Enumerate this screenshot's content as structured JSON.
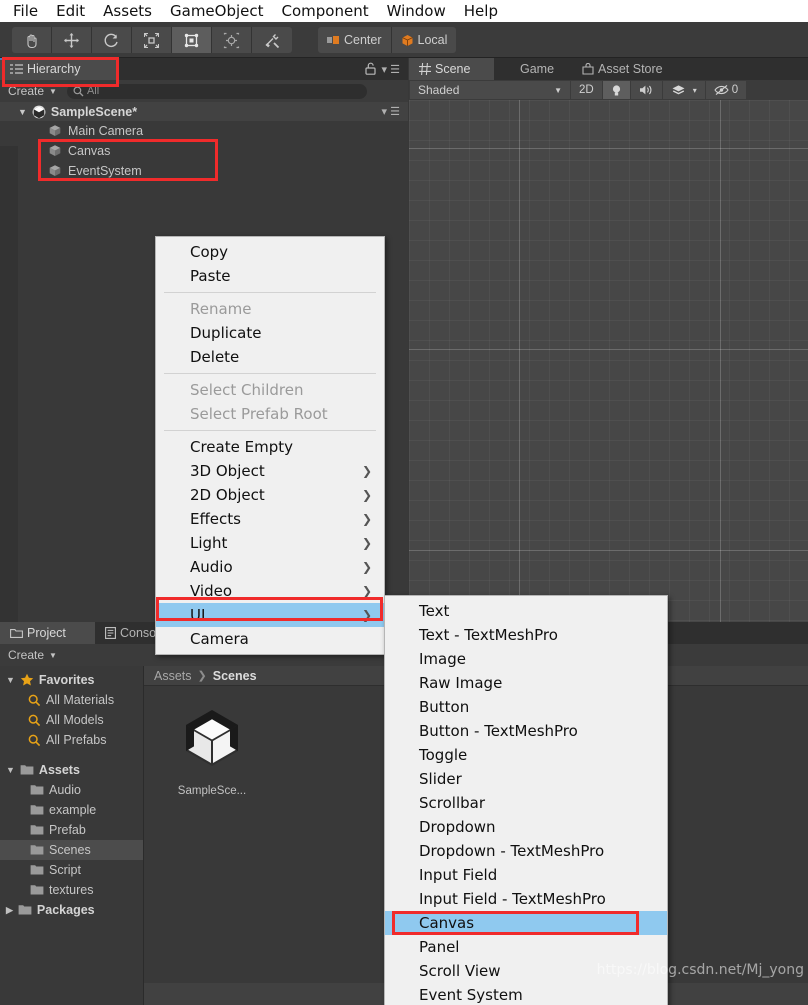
{
  "menubar": {
    "items": [
      "File",
      "Edit",
      "Assets",
      "GameObject",
      "Component",
      "Window",
      "Help"
    ]
  },
  "toolbar": {
    "tools": [
      {
        "name": "hand-tool",
        "icon": "hand-icon",
        "active": false
      },
      {
        "name": "move-tool",
        "icon": "move-icon",
        "active": false
      },
      {
        "name": "rotate-tool",
        "icon": "rotate-icon",
        "active": false
      },
      {
        "name": "scale-tool",
        "icon": "scale-icon",
        "active": false
      },
      {
        "name": "rect-tool",
        "icon": "rect-icon",
        "active": true
      },
      {
        "name": "transform-tool",
        "icon": "transform-icon",
        "active": false
      },
      {
        "name": "custom-tool",
        "icon": "wrench-icon",
        "active": false
      }
    ],
    "pivot_label": "Center",
    "space_label": "Local"
  },
  "hierarchy": {
    "tab_label": "Hierarchy",
    "create_label": "Create",
    "search_value": "All",
    "search_placeholder": "All",
    "scene_name": "SampleScene*",
    "objects": [
      {
        "label": "Main Camera"
      },
      {
        "label": "Canvas"
      },
      {
        "label": "EventSystem"
      }
    ]
  },
  "sceneview": {
    "tabs": [
      {
        "label": "Scene",
        "icon": "grid-icon",
        "active": true
      },
      {
        "label": "Game",
        "icon": "gamepad-icon",
        "active": false
      },
      {
        "label": "Asset Store",
        "icon": "store-icon",
        "active": false
      }
    ],
    "draw_mode": "Shaded",
    "toggle_2d": "2D",
    "lighting_icon": "bulb-icon",
    "audio_icon": "speaker-icon",
    "effects_icon": "fx-icon",
    "visibility_icon": "eye-off-icon",
    "hidden_count": "0"
  },
  "project": {
    "tabs": [
      {
        "label": "Project",
        "icon": "folder-icon",
        "active": true
      },
      {
        "label": "Console",
        "icon": "console-icon",
        "active": false
      }
    ],
    "create_label": "Create",
    "breadcrumb": [
      "Assets",
      "Scenes"
    ],
    "favorites": {
      "label": "Favorites",
      "items": [
        "All Materials",
        "All Models",
        "All Prefabs"
      ]
    },
    "assets": {
      "label": "Assets",
      "items": [
        {
          "label": "Audio",
          "selected": false
        },
        {
          "label": "example",
          "selected": false
        },
        {
          "label": "Prefab",
          "selected": false
        },
        {
          "label": "Scenes",
          "selected": true
        },
        {
          "label": "Script",
          "selected": false
        },
        {
          "label": "textures",
          "selected": false
        }
      ]
    },
    "packages_label": "Packages",
    "asset_items": [
      {
        "label": "SampleSce...",
        "icon": "unity-scene-icon"
      }
    ]
  },
  "context_menu": {
    "items": [
      {
        "label": "Copy",
        "disabled": false,
        "submenu": false,
        "highlighted": false
      },
      {
        "label": "Paste",
        "disabled": false,
        "submenu": false,
        "highlighted": false
      },
      {
        "separator": true
      },
      {
        "label": "Rename",
        "disabled": true,
        "submenu": false,
        "highlighted": false
      },
      {
        "label": "Duplicate",
        "disabled": false,
        "submenu": false,
        "highlighted": false
      },
      {
        "label": "Delete",
        "disabled": false,
        "submenu": false,
        "highlighted": false
      },
      {
        "separator": true
      },
      {
        "label": "Select Children",
        "disabled": true,
        "submenu": false,
        "highlighted": false
      },
      {
        "label": "Select Prefab Root",
        "disabled": true,
        "submenu": false,
        "highlighted": false
      },
      {
        "separator": true
      },
      {
        "label": "Create Empty",
        "disabled": false,
        "submenu": false,
        "highlighted": false
      },
      {
        "label": "3D Object",
        "disabled": false,
        "submenu": true,
        "highlighted": false
      },
      {
        "label": "2D Object",
        "disabled": false,
        "submenu": true,
        "highlighted": false
      },
      {
        "label": "Effects",
        "disabled": false,
        "submenu": true,
        "highlighted": false
      },
      {
        "label": "Light",
        "disabled": false,
        "submenu": true,
        "highlighted": false
      },
      {
        "label": "Audio",
        "disabled": false,
        "submenu": true,
        "highlighted": false
      },
      {
        "label": "Video",
        "disabled": false,
        "submenu": true,
        "highlighted": false
      },
      {
        "label": "UI",
        "disabled": false,
        "submenu": true,
        "highlighted": true
      },
      {
        "label": "Camera",
        "disabled": false,
        "submenu": false,
        "highlighted": false
      }
    ]
  },
  "ui_submenu": {
    "items": [
      {
        "label": "Text",
        "highlighted": false
      },
      {
        "label": "Text - TextMeshPro",
        "highlighted": false
      },
      {
        "label": "Image",
        "highlighted": false
      },
      {
        "label": "Raw Image",
        "highlighted": false
      },
      {
        "label": "Button",
        "highlighted": false
      },
      {
        "label": "Button - TextMeshPro",
        "highlighted": false
      },
      {
        "label": "Toggle",
        "highlighted": false
      },
      {
        "label": "Slider",
        "highlighted": false
      },
      {
        "label": "Scrollbar",
        "highlighted": false
      },
      {
        "label": "Dropdown",
        "highlighted": false
      },
      {
        "label": "Dropdown - TextMeshPro",
        "highlighted": false
      },
      {
        "label": "Input Field",
        "highlighted": false
      },
      {
        "label": "Input Field - TextMeshPro",
        "highlighted": false
      },
      {
        "label": "Canvas",
        "highlighted": true
      },
      {
        "label": "Panel",
        "highlighted": false
      },
      {
        "label": "Scroll View",
        "highlighted": false
      },
      {
        "label": "Event System",
        "highlighted": false
      }
    ]
  },
  "annotations": {
    "color": "#f02b2b",
    "boxes": [
      "hierarchy-tab",
      "canvas-eventsystem-rows",
      "ui-menu-item",
      "canvas-submenu-item"
    ]
  },
  "watermark": "https://blog.csdn.net/Mj_yong"
}
